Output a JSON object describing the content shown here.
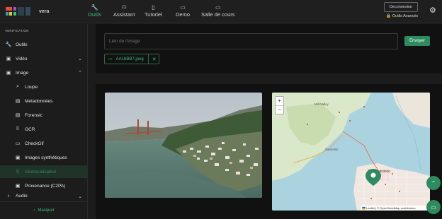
{
  "header": {
    "logo_text": "vera",
    "nav": [
      {
        "label": "Outils",
        "icon": "wrench-icon",
        "glyph": "🔧"
      },
      {
        "label": "Assistant",
        "icon": "robot-icon",
        "glyph": "⚇"
      },
      {
        "label": "Tutoriel",
        "icon": "book-icon",
        "glyph": "▯"
      },
      {
        "label": "Demo",
        "icon": "monitor-icon",
        "glyph": "▭"
      },
      {
        "label": "Salle de cours",
        "icon": "classroom-icon",
        "glyph": "▭"
      }
    ],
    "deconnexion_label": "Deconnexion",
    "advanced_label": "Outils Avancés",
    "accent": "#3fb87f"
  },
  "sidebar": {
    "section_title": "VERIFICATION",
    "items": [
      {
        "label": "Outils",
        "icon": "wrench-icon",
        "glyph": "🔧"
      },
      {
        "label": "Vidéo",
        "icon": "video-icon",
        "glyph": "▣"
      },
      {
        "label": "Image",
        "icon": "image-icon",
        "glyph": "▣"
      },
      {
        "label": "Loupe",
        "icon": "magnifier-icon",
        "glyph": "🔍"
      },
      {
        "label": "Metadonnées",
        "icon": "document-icon",
        "glyph": "▤"
      },
      {
        "label": "Forensic",
        "icon": "forensic-icon",
        "glyph": "▤"
      },
      {
        "label": "OCR",
        "icon": "ocr-icon",
        "glyph": "⌷"
      },
      {
        "label": "CheckGif",
        "icon": "gif-icon",
        "glyph": "▭"
      },
      {
        "label": "Images synthétiques",
        "icon": "synthetic-image-icon",
        "glyph": "▣"
      },
      {
        "label": "Géolocalisation",
        "icon": "location-pin-icon",
        "glyph": "⚲"
      },
      {
        "label": "Provenance (C2PA)",
        "icon": "provenance-icon",
        "glyph": "▣"
      },
      {
        "label": "Audio",
        "icon": "audio-icon",
        "glyph": "♪"
      }
    ],
    "hide_label": "Masquer"
  },
  "upload": {
    "url_placeholder": "Lien de l'image",
    "send_label": "Envoyer",
    "file_name": "AA1bBB7.jpeg"
  },
  "map": {
    "zoom_in": "+",
    "zoom_out": "−",
    "attribution": "🇺🇦 Leaflet | © OpenStreetMap contributors",
    "city_label": "San Francisco",
    "town_labels": [
      "Mill Valley",
      "Sausalito"
    ]
  },
  "fabs": [
    "chevron-up-icon",
    "chat-icon"
  ]
}
